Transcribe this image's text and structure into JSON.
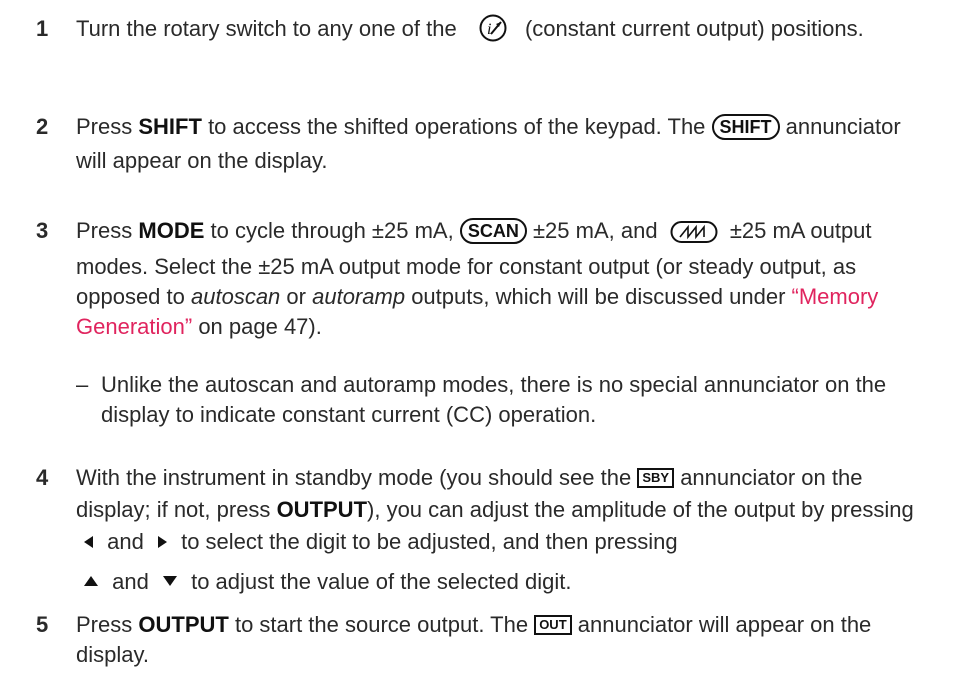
{
  "steps": [
    {
      "num": "1",
      "t1": "Turn the rotary switch to any one of the",
      "t2": "(constant current output) positions."
    },
    {
      "num": "2",
      "t1": "Press",
      "k1": "SHIFT",
      "t2": "to access the shifted operations of the keypad. The",
      "ann": "SHIFT",
      "t3": "annunciator will appear on the display."
    },
    {
      "num": "3",
      "t1": "Press",
      "k1": "MODE",
      "t2": "to cycle through ±25 mA,",
      "ann": "SCAN",
      "t3": "±25 mA, and",
      "t4": "±25 mA output modes. Select the ±25 mA output mode for constant output (or steady output, as opposed to",
      "i1": "autoscan",
      "t5": "or",
      "i2": "autoramp",
      "t6": "outputs, which will be discussed under",
      "link": "“Memory Generation”",
      "t7": "on page 47)."
    },
    {
      "num": "4",
      "t1": "With the instrument in standby mode (you should see the",
      "ann": "SBY",
      "t2": "annunciator on the display; if not, press",
      "k1": "OUTPUT",
      "t3": "), you can adjust the amplitude of the output by pressing",
      "and1": "and",
      "t4": "to select the digit to be adjusted, and then pressing",
      "and2": "and",
      "t5": "to adjust the value of the selected digit."
    },
    {
      "num": "5",
      "t1": "Press",
      "k1": "OUTPUT",
      "t2": "to start the source output. The",
      "ann": "OUT",
      "t3": "annunciator will appear on the display."
    }
  ],
  "bullet": {
    "dash": "–",
    "text": "Unlike the autoscan and autoramp modes, there is no special annunciator on the display to indicate constant current (CC) operation."
  },
  "icons": [
    "constant-current-icon",
    "ramp-wave-icon",
    "left-arrow-icon",
    "right-arrow-icon",
    "up-arrow-icon",
    "down-arrow-icon"
  ]
}
